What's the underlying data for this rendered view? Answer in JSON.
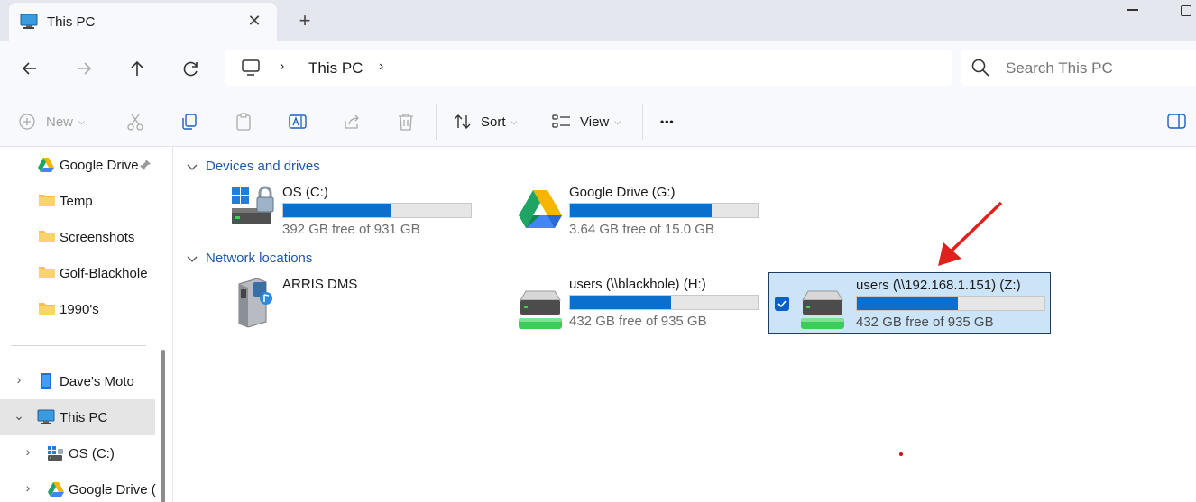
{
  "tab": {
    "title": "This PC",
    "close_glyph": "✕",
    "new_glyph": "+"
  },
  "address": {
    "crumb": "This PC",
    "chevron": "›"
  },
  "search": {
    "placeholder": "Search This PC"
  },
  "toolbar": {
    "new_label": "New",
    "sort_label": "Sort",
    "view_label": "View",
    "more_label": "•••",
    "caret": "⌵"
  },
  "sidebar": {
    "items": [
      {
        "label": "Google Drive",
        "icon": "google-drive-icon",
        "pinned": true
      },
      {
        "label": "Temp",
        "icon": "folder-icon"
      },
      {
        "label": "Screenshots",
        "icon": "folder-icon"
      },
      {
        "label": "Golf-Blackhole",
        "icon": "folder-icon"
      },
      {
        "label": "1990's",
        "icon": "folder-icon"
      },
      {
        "label": "Dave's Moto",
        "icon": "phone-icon"
      },
      {
        "label": "This PC",
        "icon": "monitor-icon",
        "selected": true
      },
      {
        "label": "OS (C:)",
        "icon": "os-drive-icon"
      },
      {
        "label": "Google Drive (",
        "icon": "google-drive-icon"
      }
    ],
    "expand_closed": "›",
    "expand_open": "⌄"
  },
  "groups": {
    "devices": "Devices and drives",
    "network": "Network locations"
  },
  "drives": [
    {
      "name": "OS (C:)",
      "free": "392 GB free of 931 GB",
      "used_fraction": 0.579,
      "icon": "windows-os-drive-locked-icon"
    },
    {
      "name": "Google Drive (G:)",
      "free": "3.64 GB free of 15.0 GB",
      "used_fraction": 0.757,
      "icon": "google-drive-icon"
    }
  ],
  "network": [
    {
      "name": "ARRIS DMS",
      "icon": "media-server-icon"
    },
    {
      "name": "users (\\\\blackhole) (H:)",
      "free": "432 GB free of 935 GB",
      "used_fraction": 0.538,
      "icon": "network-drive-icon"
    },
    {
      "name": "users (\\\\192.168.1.151) (Z:)",
      "free": "432 GB free of 935 GB",
      "used_fraction": 0.538,
      "icon": "network-drive-icon",
      "selected": true
    }
  ],
  "colors": {
    "accent": "#0a6fcd",
    "selection": "#cce4f7",
    "group_header": "#1f56a8",
    "annotation_arrow": "#e0201c"
  }
}
